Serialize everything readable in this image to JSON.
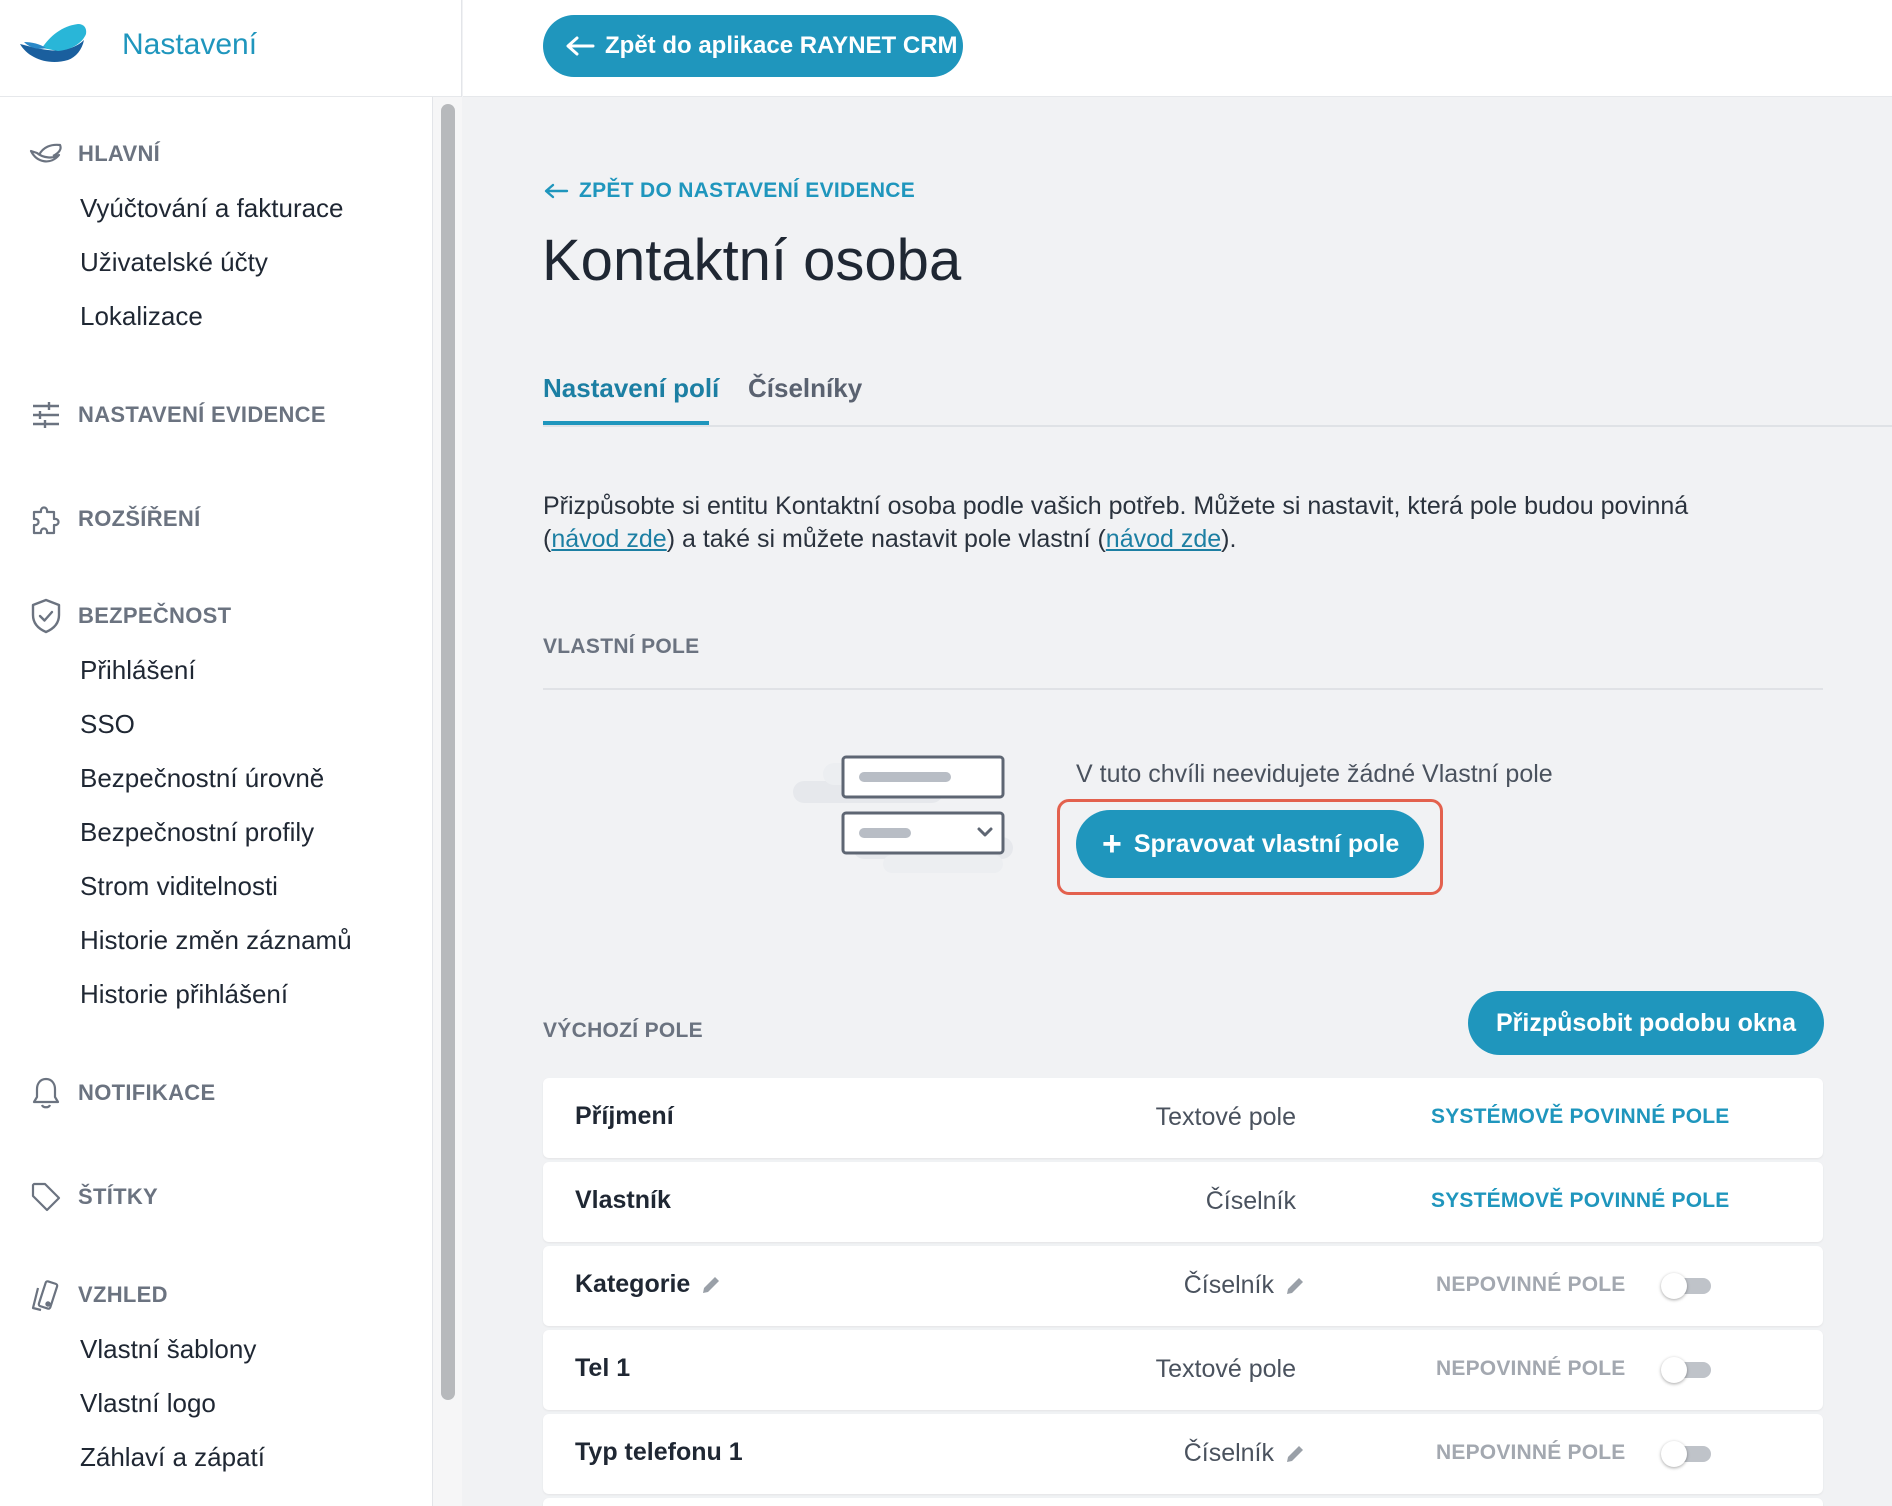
{
  "sidebar": {
    "title": "Nastavení",
    "sections": {
      "hlavni": {
        "label": "HLAVNÍ",
        "items": [
          "Vyúčtování a fakturace",
          "Uživatelské účty",
          "Lokalizace"
        ]
      },
      "evidence": {
        "label": "NASTAVENÍ EVIDENCE"
      },
      "rozsireni": {
        "label": "ROZŠÍŘENÍ"
      },
      "bezpecnost": {
        "label": "BEZPEČNOST",
        "items": [
          "Přihlášení",
          "SSO",
          "Bezpečnostní úrovně",
          "Bezpečnostní profily",
          "Strom viditelnosti",
          "Historie změn záznamů",
          "Historie přihlášení"
        ]
      },
      "notifikace": {
        "label": "NOTIFIKACE"
      },
      "stitky": {
        "label": "ŠTÍTKY"
      },
      "vzhled": {
        "label": "VZHLED",
        "items": [
          "Vlastní šablony",
          "Vlastní logo",
          "Záhlaví a zápatí"
        ]
      }
    }
  },
  "topbar": {
    "back_app_label": "Zpět do aplikace RAYNET CRM"
  },
  "main": {
    "back_link": "ZPĚT DO NASTAVENÍ EVIDENCE",
    "title": "Kontaktní osoba",
    "tabs": [
      {
        "label": "Nastavení polí",
        "active": true
      },
      {
        "label": "Číselníky",
        "active": false
      }
    ],
    "description": {
      "part1": "Přizpůsobte si entitu Kontaktní osoba podle vašich potřeb. Můžete si nastavit, která pole budou povinná (",
      "link1": "návod zde",
      "part2": ") a také si můžete nastavit pole vlastní (",
      "link2": "návod zde",
      "part3": ")."
    },
    "custom_fields": {
      "heading": "VLASTNÍ POLE",
      "empty_text": "V tuto chvíli neevidujete žádné Vlastní pole",
      "manage_button": "Spravovat vlastní pole",
      "manage_button_icon": "plus-icon"
    },
    "default_fields": {
      "heading": "VÝCHOZÍ POLE",
      "customize_button": "Přizpůsobit podobu okna",
      "rows": [
        {
          "name": "Příjmení",
          "type": "Textové pole",
          "status": "SYSTÉMOVĚ POVINNÉ POLE",
          "system": true,
          "name_editable": false,
          "type_editable": false
        },
        {
          "name": "Vlastník",
          "type": "Číselník",
          "status": "SYSTÉMOVĚ POVINNÉ POLE",
          "system": true,
          "name_editable": false,
          "type_editable": false
        },
        {
          "name": "Kategorie",
          "type": "Číselník",
          "status": "NEPOVINNÉ POLE",
          "system": false,
          "name_editable": true,
          "type_editable": true,
          "toggle_on": false
        },
        {
          "name": "Tel 1",
          "type": "Textové pole",
          "status": "NEPOVINNÉ POLE",
          "system": false,
          "name_editable": false,
          "type_editable": false,
          "toggle_on": false
        },
        {
          "name": "Typ telefonu 1",
          "type": "Číselník",
          "status": "NEPOVINNÉ POLE",
          "system": false,
          "name_editable": false,
          "type_editable": true,
          "toggle_on": false
        }
      ]
    }
  },
  "colors": {
    "accent": "#1f96bd",
    "highlight": "#e3614e",
    "muted": "#6b7380"
  }
}
